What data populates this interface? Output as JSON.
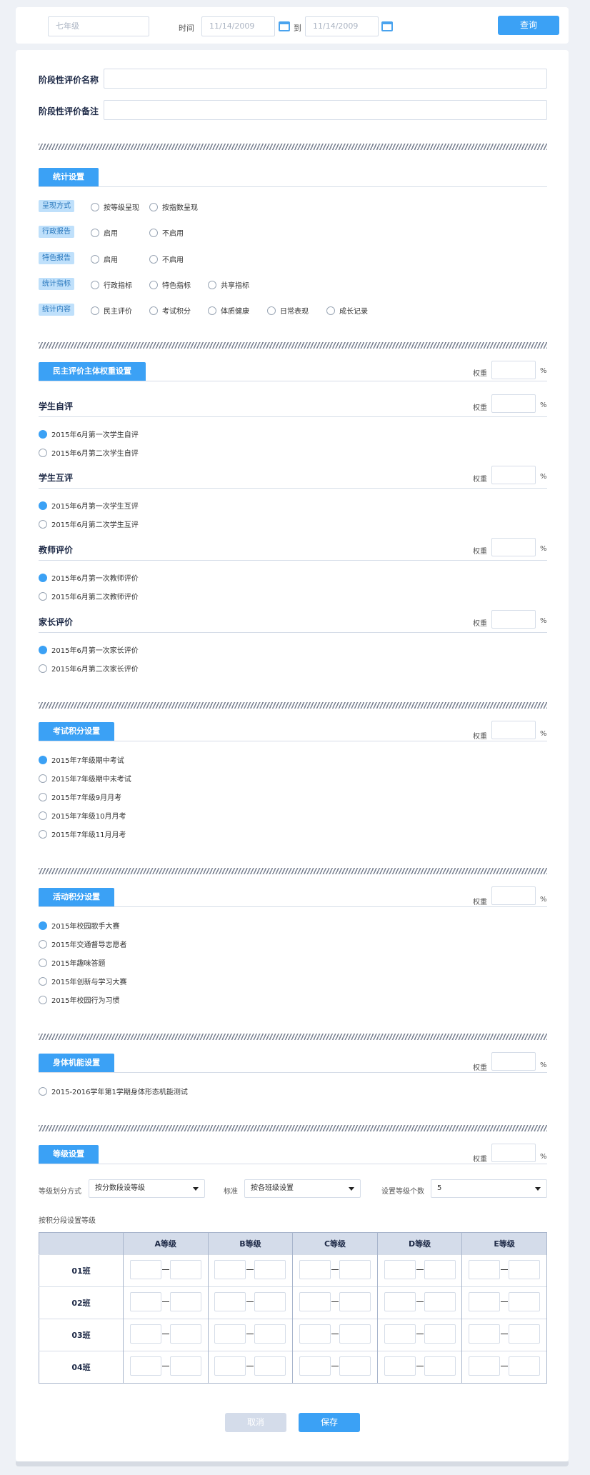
{
  "filter": {
    "grade_placeholder": "七年级",
    "time_label": "时间",
    "date_from": "11/14/2009",
    "to_label": "到",
    "date_to": "11/14/2009",
    "query_button": "查询"
  },
  "form": {
    "name_label": "阶段性评价名称",
    "note_label": "阶段性评价备注"
  },
  "stats": {
    "tab": "统计设置",
    "rows": [
      {
        "tag": "呈现方式",
        "options": [
          "按等级呈现",
          "按指数呈现"
        ]
      },
      {
        "tag": "行政报告",
        "options": [
          "启用",
          "不启用"
        ]
      },
      {
        "tag": "特色报告",
        "options": [
          "启用",
          "不启用"
        ]
      },
      {
        "tag": "统计指标",
        "options": [
          "行政指标",
          "特色指标",
          "共享指标"
        ]
      },
      {
        "tag": "统计内容",
        "options": [
          "民主评价",
          "考试积分",
          "体质健康",
          "日常表现",
          "成长记录"
        ]
      }
    ]
  },
  "weight_label": "权重",
  "percent": "%",
  "democratic": {
    "tab": "民主评价主体权重设置",
    "groups": [
      {
        "title": "学生自评",
        "items": [
          "2015年6月第一次学生自评",
          "2015年6月第二次学生自评"
        ]
      },
      {
        "title": "学生互评",
        "items": [
          "2015年6月第一次学生互评",
          "2015年6月第二次学生互评"
        ]
      },
      {
        "title": "教师评价",
        "items": [
          "2015年6月第一次教师评价",
          "2015年6月第二次教师评价"
        ]
      },
      {
        "title": "家长评价",
        "items": [
          "2015年6月第一次家长评价",
          "2015年6月第二次家长评价"
        ]
      }
    ]
  },
  "exam": {
    "tab": "考试积分设置",
    "items": [
      "2015年7年级期中考试",
      "2015年7年级期中末考试",
      "2015年7年级9月月考",
      "2015年7年级10月月考",
      "2015年7年级11月月考"
    ]
  },
  "activity": {
    "tab": "活动积分设置",
    "items": [
      "2015年校园歌手大赛",
      "2015年交通督导志愿者",
      "2015年趣味答题",
      "2015年创新与学习大赛",
      "2015年校园行为习惯"
    ]
  },
  "physical": {
    "tab": "身体机能设置",
    "items": [
      "2015-2016学年第1学期身体形态机能测试"
    ]
  },
  "level": {
    "tab": "等级设置",
    "method_label": "等级划分方式",
    "method_value": "按分数段设等级",
    "standard_label": "标准",
    "standard_value": "按各班级设置",
    "count_label": "设置等级个数",
    "count_value": "5",
    "grid_caption": "按积分段设置等级",
    "columns": [
      "A等级",
      "B等级",
      "C等级",
      "D等级",
      "E等级"
    ],
    "rows": [
      "01班",
      "02班",
      "03班",
      "04班"
    ]
  },
  "actions": {
    "cancel": "取消",
    "save": "保存"
  }
}
